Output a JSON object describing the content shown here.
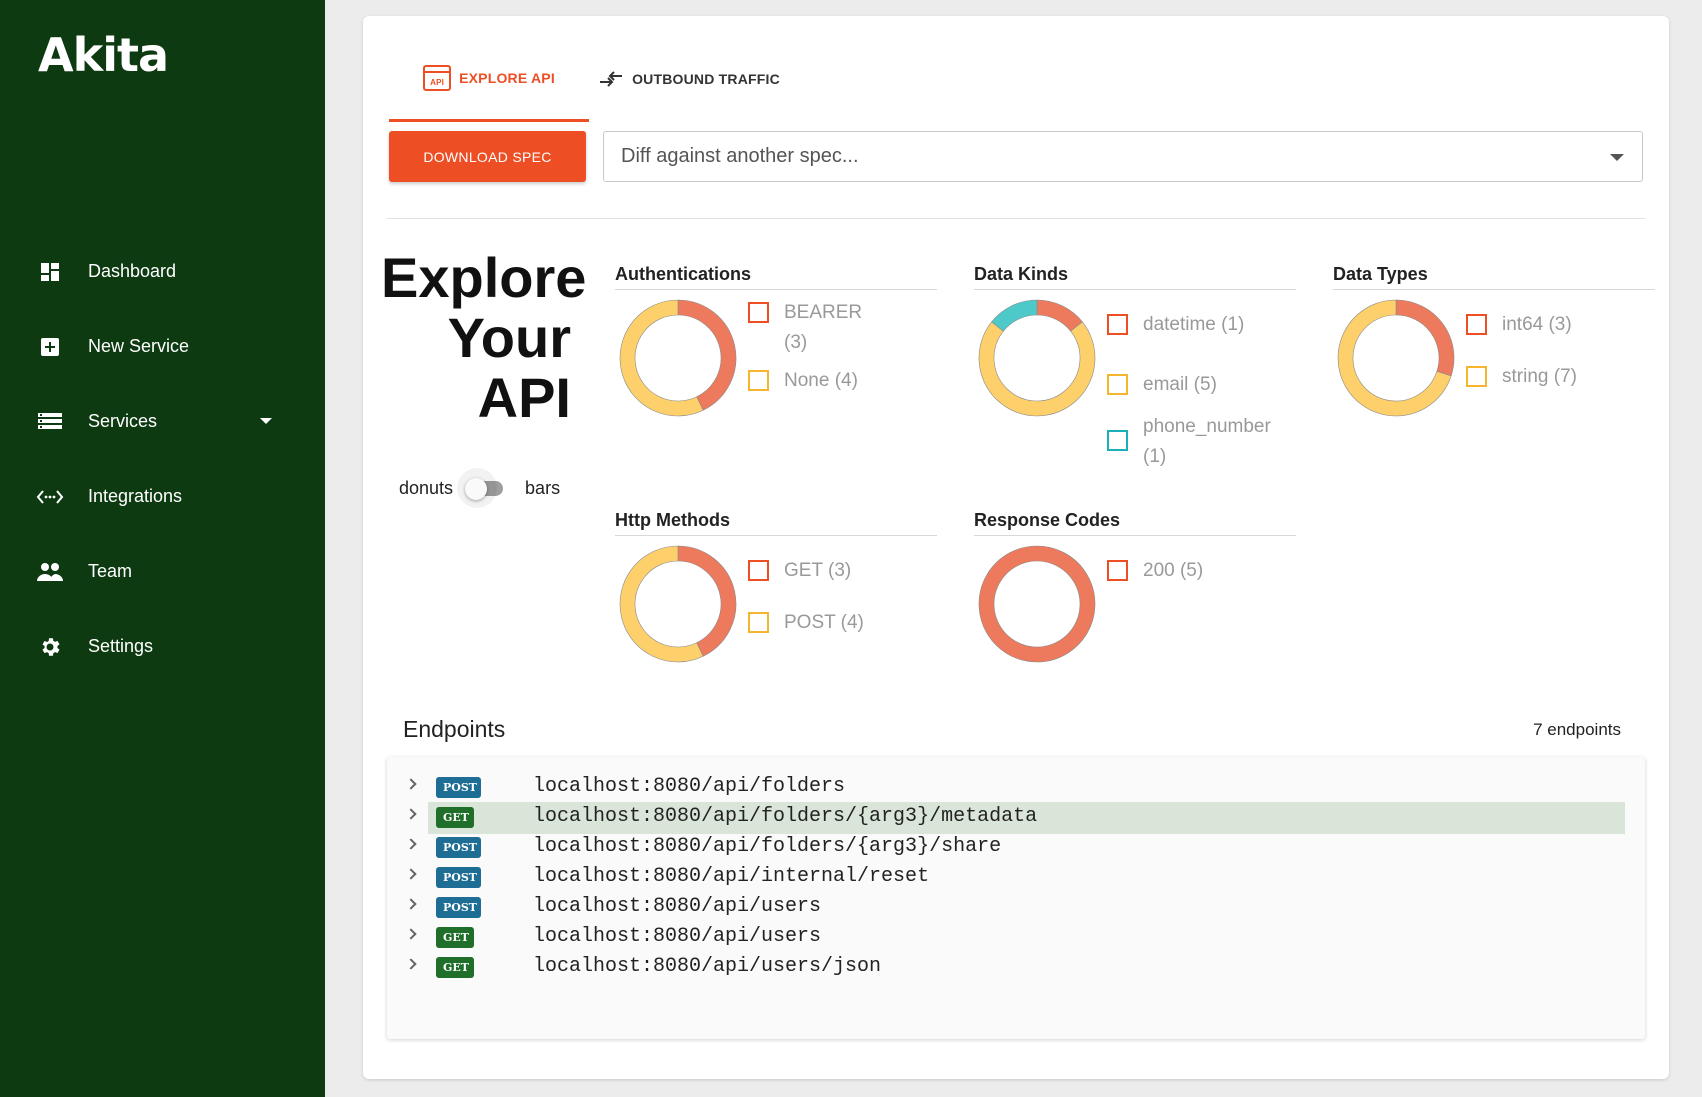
{
  "sidebar": {
    "logo": "Akita",
    "items": [
      {
        "label": "Dashboard",
        "icon": "dashboard-icon"
      },
      {
        "label": "New Service",
        "icon": "add-box-icon"
      },
      {
        "label": "Services",
        "icon": "storage-icon"
      },
      {
        "label": "Integrations",
        "icon": "code-icon"
      },
      {
        "label": "Team",
        "icon": "people-icon"
      },
      {
        "label": "Settings",
        "icon": "gear-icon"
      }
    ]
  },
  "tabs": [
    {
      "label": "EXPLORE API",
      "icon": "api-icon",
      "active": true
    },
    {
      "label": "OUTBOUND TRAFFIC",
      "icon": "swap-arrows-icon",
      "active": false
    }
  ],
  "toolbar": {
    "download_label": "DOWNLOAD SPEC",
    "diff_placeholder": "Diff against another spec..."
  },
  "explore": {
    "title_lines": [
      "Explore",
      "Your",
      "API"
    ],
    "toggle_left": "donuts",
    "toggle_right": "bars",
    "toggle_on": false
  },
  "colors": {
    "accent": "#ee4e23",
    "red": "#ee7a5e",
    "yellow": "#fdd06b",
    "teal": "#4dc9c9",
    "post": "#1e6d95",
    "get": "#1f6e2a"
  },
  "stats": [
    {
      "title": "Authentications",
      "legend": [
        {
          "label": "BEARER (3)",
          "value": 3,
          "color": "#ee4e23",
          "fill": "#ee7a5e"
        },
        {
          "label": "None (4)",
          "value": 4,
          "color": "#f5b52e",
          "fill": "#fdd06b"
        }
      ]
    },
    {
      "title": "Data Kinds",
      "legend": [
        {
          "label": "datetime (1)",
          "value": 1,
          "color": "#ee4e23",
          "fill": "#ee7a5e"
        },
        {
          "label": "email (5)",
          "value": 5,
          "color": "#f5b52e",
          "fill": "#fdd06b"
        },
        {
          "label": "phone_number (1)",
          "value": 1,
          "color": "#1bb0b8",
          "fill": "#4dc9c9"
        }
      ]
    },
    {
      "title": "Data Types",
      "legend": [
        {
          "label": "int64 (3)",
          "value": 3,
          "color": "#ee4e23",
          "fill": "#ee7a5e"
        },
        {
          "label": "string (7)",
          "value": 7,
          "color": "#f5b52e",
          "fill": "#fdd06b"
        }
      ]
    },
    {
      "title": "Http Methods",
      "legend": [
        {
          "label": "GET (3)",
          "value": 3,
          "color": "#ee4e23",
          "fill": "#ee7a5e"
        },
        {
          "label": "POST (4)",
          "value": 4,
          "color": "#f5b52e",
          "fill": "#fdd06b"
        }
      ]
    },
    {
      "title": "Response Codes",
      "legend": [
        {
          "label": "200 (5)",
          "value": 5,
          "color": "#ee4e23",
          "fill": "#ee7a5e"
        }
      ]
    }
  ],
  "endpoints": {
    "title": "Endpoints",
    "count": "7 endpoints",
    "rows": [
      {
        "method": "POST",
        "path": "localhost:8080/api/folders",
        "highlighted": false
      },
      {
        "method": "GET",
        "path": "localhost:8080/api/folders/{arg3}/metadata",
        "highlighted": true
      },
      {
        "method": "POST",
        "path": "localhost:8080/api/folders/{arg3}/share",
        "highlighted": false
      },
      {
        "method": "POST",
        "path": "localhost:8080/api/internal/reset",
        "highlighted": false
      },
      {
        "method": "POST",
        "path": "localhost:8080/api/users",
        "highlighted": false
      },
      {
        "method": "GET",
        "path": "localhost:8080/api/users",
        "highlighted": false
      },
      {
        "method": "GET",
        "path": "localhost:8080/api/users/json",
        "highlighted": false
      }
    ]
  }
}
